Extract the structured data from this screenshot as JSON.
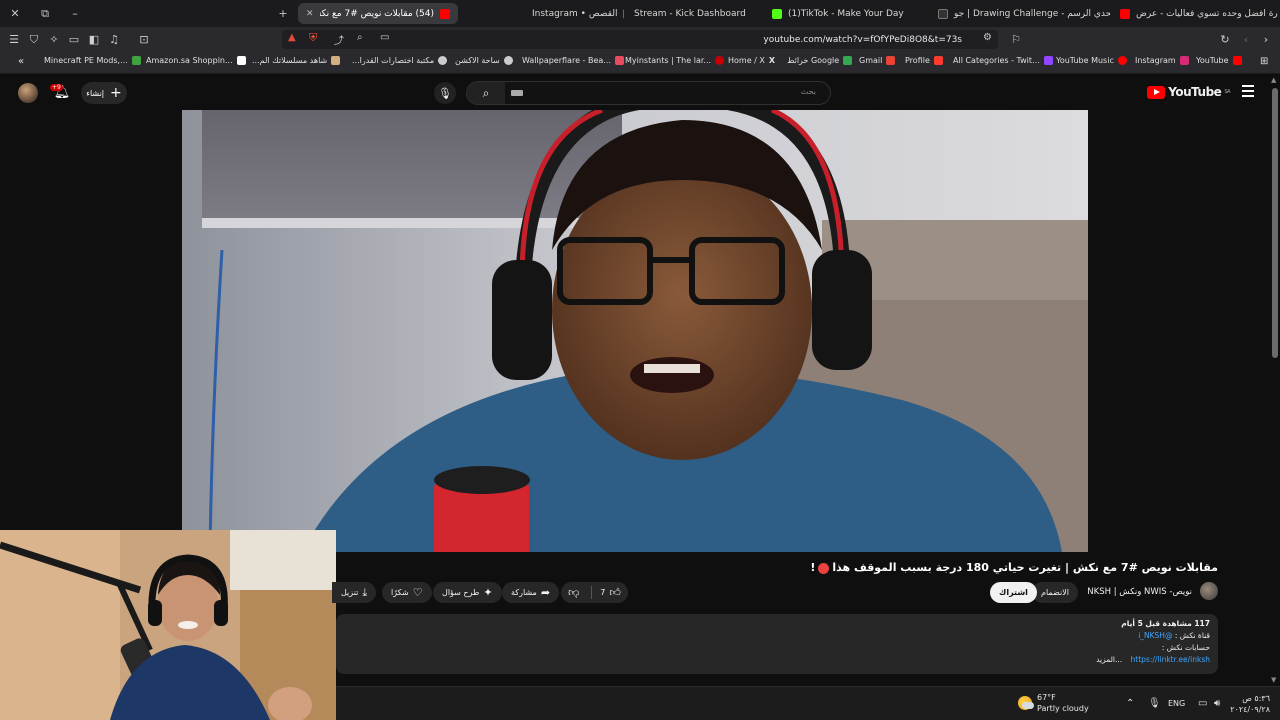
{
  "browser": {
    "window_controls": {
      "close": "✕",
      "restore": "⧉",
      "minimize": "–",
      "new_tab": "+"
    },
    "tabs": [
      {
        "label": "(54) مقابلات نويص #7 مع نكش |",
        "active": true,
        "favicon_color": "#ff0000"
      },
      {
        "label": "Instagram • القصص",
        "active": false,
        "favicon_color": "#d62976"
      },
      {
        "label": "Stream - Kick Dashboard",
        "active": false,
        "favicon_color": "#53fc18"
      },
      {
        "label": "(1)TikTok - Make Your Day",
        "active": false,
        "favicon_color": "#000000"
      },
      {
        "label": "تحدي الرسم - Drawing Challenge | جو",
        "active": false,
        "favicon_color": "#ff0000"
      },
      {
        "label": "سارة افضل وحده تسوي فعاليات - عرض",
        "active": false,
        "favicon_color": "#9146ff"
      }
    ],
    "url": "youtube.com/watch?v=fOfYPeDi8O8&t=73s",
    "bookmarks": [
      {
        "label": "YouTube",
        "favicon_color": "#ff0000"
      },
      {
        "label": "Instagram",
        "favicon_color": "#d62976"
      },
      {
        "label": "YouTube Music",
        "favicon_color": "#ff0000"
      },
      {
        "label": "All Categories - Twit...",
        "favicon_color": "#9146ff"
      },
      {
        "label": "Profile",
        "favicon_color": "#ff3b30"
      },
      {
        "label": "Gmail",
        "favicon_color": "#ea4335"
      },
      {
        "label": "خرائط Google",
        "favicon_color": "#34a853"
      },
      {
        "label": "Home / X",
        "favicon_color": "#ffffff"
      },
      {
        "label": "Myinstants | The lar...",
        "favicon_color": "#cc0000"
      },
      {
        "label": "Wallpaperflare - Bea...",
        "favicon_color": "#e84a5f"
      },
      {
        "label": "ساحة الاكشن",
        "favicon_color": "#cccccc"
      },
      {
        "label": "مكتبة اختصارات القدرا...",
        "favicon_color": "#cccccc"
      },
      {
        "label": "شاهد مسلسلاتك الم...",
        "favicon_color": "#d0b080"
      },
      {
        "label": "Amazon.sa Shoppin...",
        "favicon_color": "#ffffff"
      },
      {
        "label": "Minecraft PE Mods,...",
        "favicon_color": "#3fa33f"
      }
    ]
  },
  "youtube": {
    "create_label": "إنشاء",
    "notifications_count": "+9",
    "search_placeholder": "بحث",
    "logo_text": "YouTube",
    "region": "SA"
  },
  "video": {
    "title": "مقابلات نويص #7 مع نكش | تغيرت حياتي 180 درجة بسبب الموقف هذا",
    "channel_name": "نويص- NWIS ونكش | NKSH",
    "join_label": "الانضمام",
    "subscribe_label": "اشتراك",
    "like_count": "7",
    "share_label": "مشاركة",
    "ask_label": "طرح سؤال",
    "thanks_label": "شكرًا",
    "download_label": "تنزيل",
    "description": {
      "views_line_bold": "117 مشاهدة قبل 5 أيام",
      "line2_handle": "@i_NKSH",
      "line2_text": "قناة نكش :",
      "line3": "حسابات نكش :",
      "link": "https://linktr.ee/inksh",
      "more": "...المزيد"
    }
  },
  "taskbar": {
    "temperature": "67°F",
    "condition": "Partly cloudy",
    "language": "ENG",
    "time": "٥:٣٦ ص",
    "date": "٢٠٢٤/٠٩/٢٨"
  }
}
